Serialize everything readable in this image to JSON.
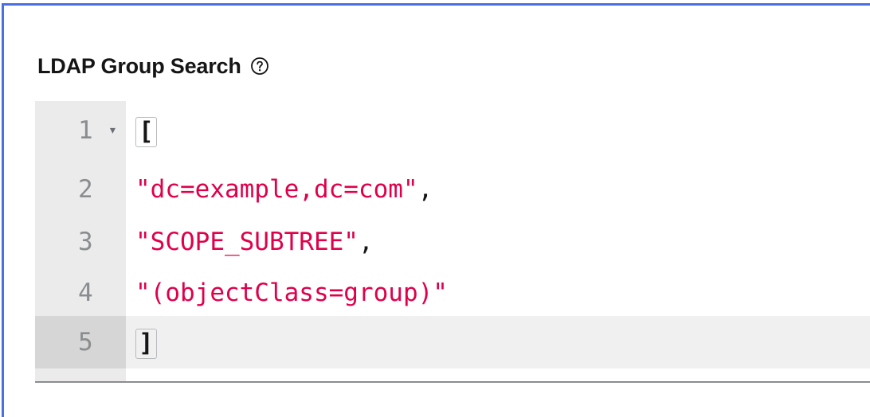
{
  "field": {
    "label": "LDAP Group Search",
    "help_icon": "question-circle-icon"
  },
  "editor": {
    "lines": [
      {
        "number": "1",
        "fold": "▾",
        "bracket": "["
      },
      {
        "number": "2",
        "string": "\"dc=example,dc=com\"",
        "punct": ","
      },
      {
        "number": "3",
        "string": "\"SCOPE_SUBTREE\"",
        "punct": ","
      },
      {
        "number": "4",
        "string": "\"(objectClass=group)\""
      },
      {
        "number": "5",
        "bracket": "]"
      }
    ],
    "active_line": "5"
  },
  "colors": {
    "focus_border": "#4a6fe3",
    "string": "#e0004a",
    "gutter": "#ebebeb",
    "active_line": "#f0f0f0"
  }
}
